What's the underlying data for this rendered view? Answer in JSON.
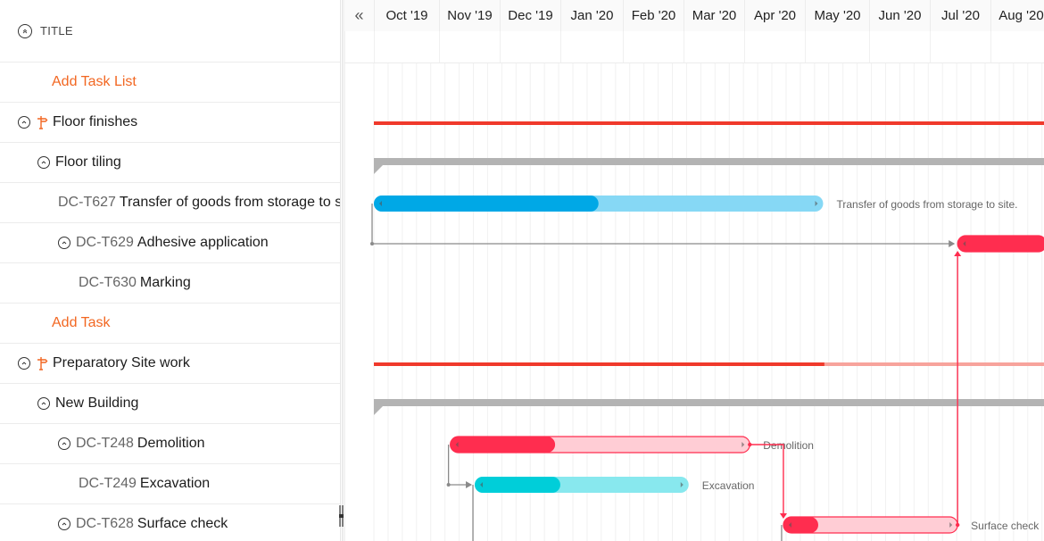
{
  "left_panel": {
    "header_title": "TITLE",
    "rows": [
      {
        "type": "add",
        "label": "Add Task List",
        "indent": 58
      },
      {
        "type": "tasklist",
        "label": "Floor finishes",
        "indent": 20,
        "chevron": true,
        "milestone": true
      },
      {
        "type": "group",
        "label": "Floor tiling",
        "indent": 42,
        "chevron": true
      },
      {
        "type": "task",
        "id": "DC-T627",
        "label": "Transfer of goods from storage to site.",
        "indent": 65
      },
      {
        "type": "task",
        "id": "DC-T629",
        "label": "Adhesive application",
        "indent": 65,
        "chevron": true
      },
      {
        "type": "task",
        "id": "DC-T630",
        "label": "Marking",
        "indent": 88
      },
      {
        "type": "add",
        "label": "Add Task",
        "indent": 58
      },
      {
        "type": "tasklist",
        "label": "Preparatory Site work",
        "indent": 20,
        "chevron": true,
        "milestone": true
      },
      {
        "type": "group",
        "label": "New Building",
        "indent": 42,
        "chevron": true
      },
      {
        "type": "task",
        "id": "DC-T248",
        "label": "Demolition",
        "indent": 65,
        "chevron": true
      },
      {
        "type": "task",
        "id": "DC-T249",
        "label": "Excavation",
        "indent": 88
      },
      {
        "type": "task",
        "id": "DC-T628",
        "label": "Surface check",
        "indent": 65,
        "chevron": true
      }
    ]
  },
  "timeline": {
    "collapse_icon": "«",
    "months": [
      "Oct '19",
      "Nov '19",
      "Dec '19",
      "Jan '20",
      "Feb '20",
      "Mar '20",
      "Apr '20",
      "May '20",
      "Jun '20",
      "Jul '20",
      "Aug '20"
    ]
  },
  "colors": {
    "accent_orange": "#f26722",
    "red": "#ff2d4f",
    "red_light": "#ffcdd5",
    "blue": "#00a8e6",
    "blue_light": "#86d8f5",
    "cyan": "#00ced9",
    "cyan_light": "#88e8ee",
    "summary_red": "#f0392b",
    "summary_red_light": "#f7a39c",
    "group_gray": "#b3b3b3",
    "connector_gray": "#8a8a8a"
  },
  "chart_data": {
    "type": "gantt",
    "x_axis": {
      "unit": "month",
      "start": "2019-10",
      "labels": [
        "Oct '19",
        "Nov '19",
        "Dec '19",
        "Jan '20",
        "Feb '20",
        "Mar '20",
        "Apr '20",
        "May '20",
        "Jun '20",
        "Jul '20",
        "Aug '20"
      ]
    },
    "bars": [
      {
        "row": 1,
        "kind": "tasklist-summary",
        "name": "Floor finishes",
        "start": 0.0,
        "end": 11.0,
        "progress": 1.0
      },
      {
        "row": 2,
        "kind": "group",
        "name": "Floor tiling",
        "start": 0.0,
        "end": 11.0
      },
      {
        "row": 3,
        "kind": "task",
        "id": "DC-T627",
        "name": "Transfer of goods from storage to site.",
        "start": 0.0,
        "end": 7.35,
        "progress": 0.5,
        "color": "blue",
        "label": "Transfer of goods from storage to site."
      },
      {
        "row": 4,
        "kind": "task",
        "id": "DC-T629",
        "name": "Adhesive application",
        "start": 9.55,
        "end": 11.0,
        "progress": 1.0,
        "color": "red"
      },
      {
        "row": 7,
        "kind": "tasklist-summary",
        "name": "Preparatory Site work",
        "start": 0.0,
        "end": 11.0,
        "progress": 0.67
      },
      {
        "row": 8,
        "kind": "group",
        "name": "New Building",
        "start": 0.0,
        "end": 11.0
      },
      {
        "row": 9,
        "kind": "task",
        "id": "DC-T248",
        "name": "Demolition",
        "start": 1.25,
        "end": 6.15,
        "progress": 0.35,
        "color": "red",
        "label": "Demolition"
      },
      {
        "row": 10,
        "kind": "task",
        "id": "DC-T249",
        "name": "Excavation",
        "start": 1.65,
        "end": 5.15,
        "progress": 0.4,
        "color": "cyan",
        "label": "Excavation"
      },
      {
        "row": 11,
        "kind": "task",
        "id": "DC-T628",
        "name": "Surface check",
        "start": 6.7,
        "end": 9.55,
        "progress": 0.2,
        "color": "red",
        "label": "Surface check"
      }
    ],
    "dependencies": [
      {
        "from": "DC-T627",
        "to": "DC-T629",
        "color": "gray"
      },
      {
        "from": "DC-T248",
        "to": "DC-T249",
        "color": "gray"
      },
      {
        "from": "DC-T248",
        "to": "DC-T628",
        "color": "red"
      },
      {
        "from": "DC-T628",
        "to": "DC-T629",
        "color": "red"
      }
    ]
  }
}
